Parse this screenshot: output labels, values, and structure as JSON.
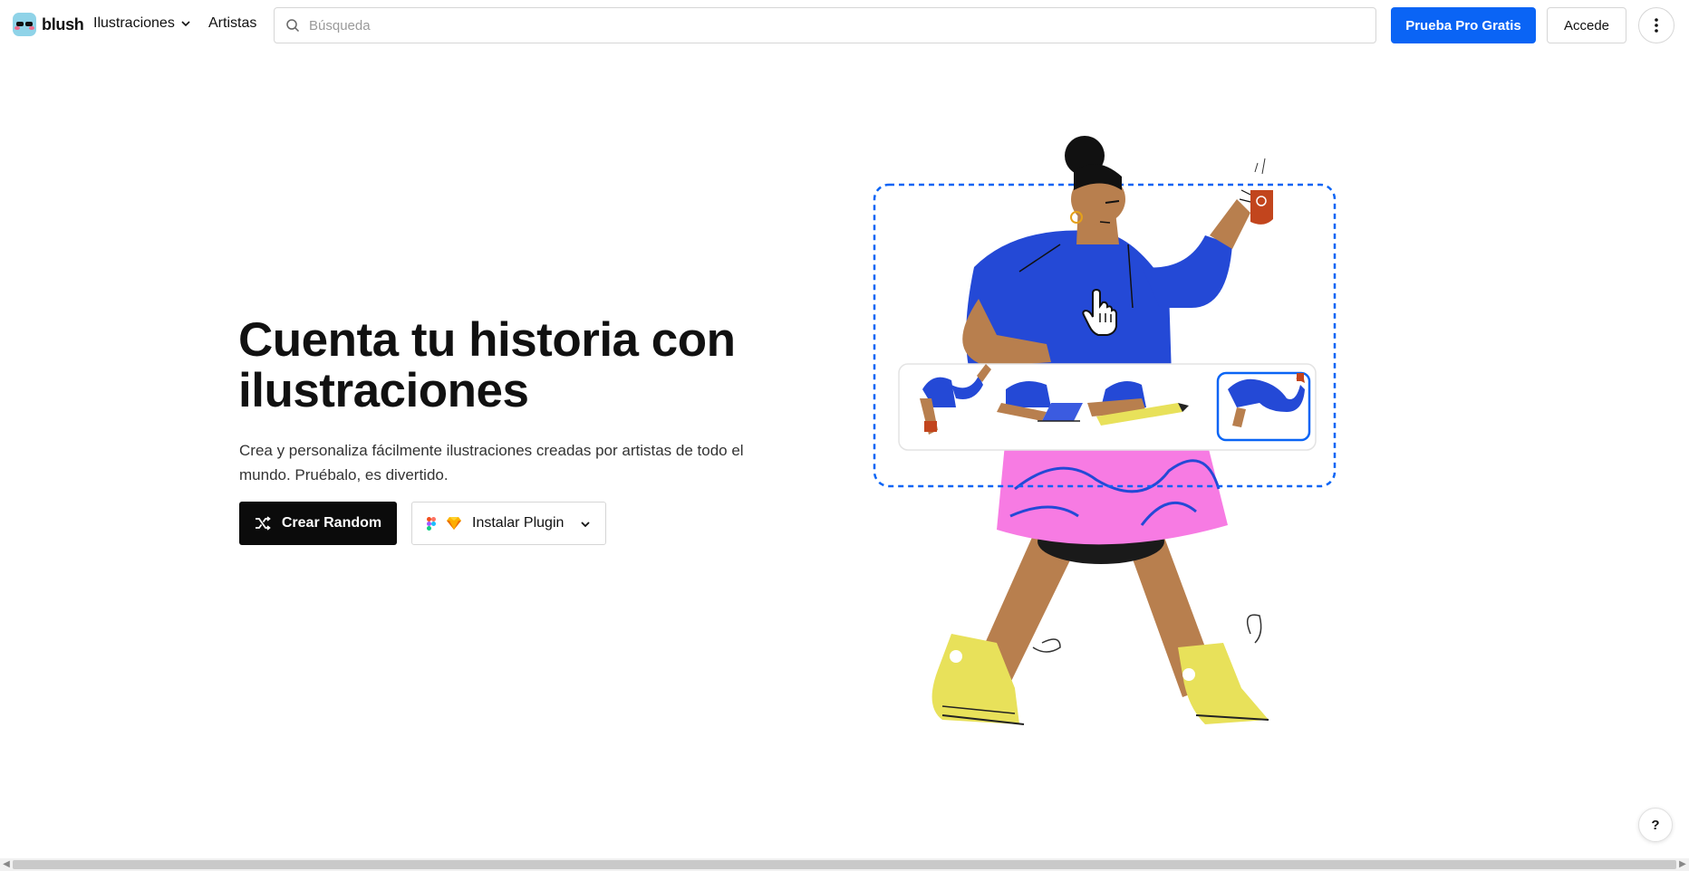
{
  "header": {
    "logo_text": "blush",
    "nav": [
      {
        "label": "Ilustraciones",
        "has_dropdown": true
      },
      {
        "label": "Artistas",
        "has_dropdown": false
      }
    ],
    "search": {
      "placeholder": "Búsqueda",
      "value": ""
    },
    "pro_button": "Prueba Pro Gratis",
    "login_button": "Accede",
    "more_icon": "vertical-dots-icon"
  },
  "hero": {
    "title": "Cuenta tu historia con ilustraciones",
    "subtitle": "Crea y personaliza fácilmente ilustraciones creadas por artistas de todo el mundo. Pruébalo, es divertido.",
    "random_button": "Crear Random",
    "plugin_button": "Instalar Plugin"
  },
  "illustration": {
    "description_icons": [
      "figma-icon",
      "sketch-icon",
      "shuffle-icon",
      "hand-cursor-icon"
    ],
    "variant_count": 4,
    "selected_variant": 4
  },
  "help_button": "?",
  "colors": {
    "brand_blue": "#0a64f5",
    "sweater_blue": "#2449d6",
    "skirt_pink": "#f77be3",
    "shoe_yellow": "#e8e15a",
    "skin": "#b87f4e",
    "mug_red": "#c2451d"
  }
}
